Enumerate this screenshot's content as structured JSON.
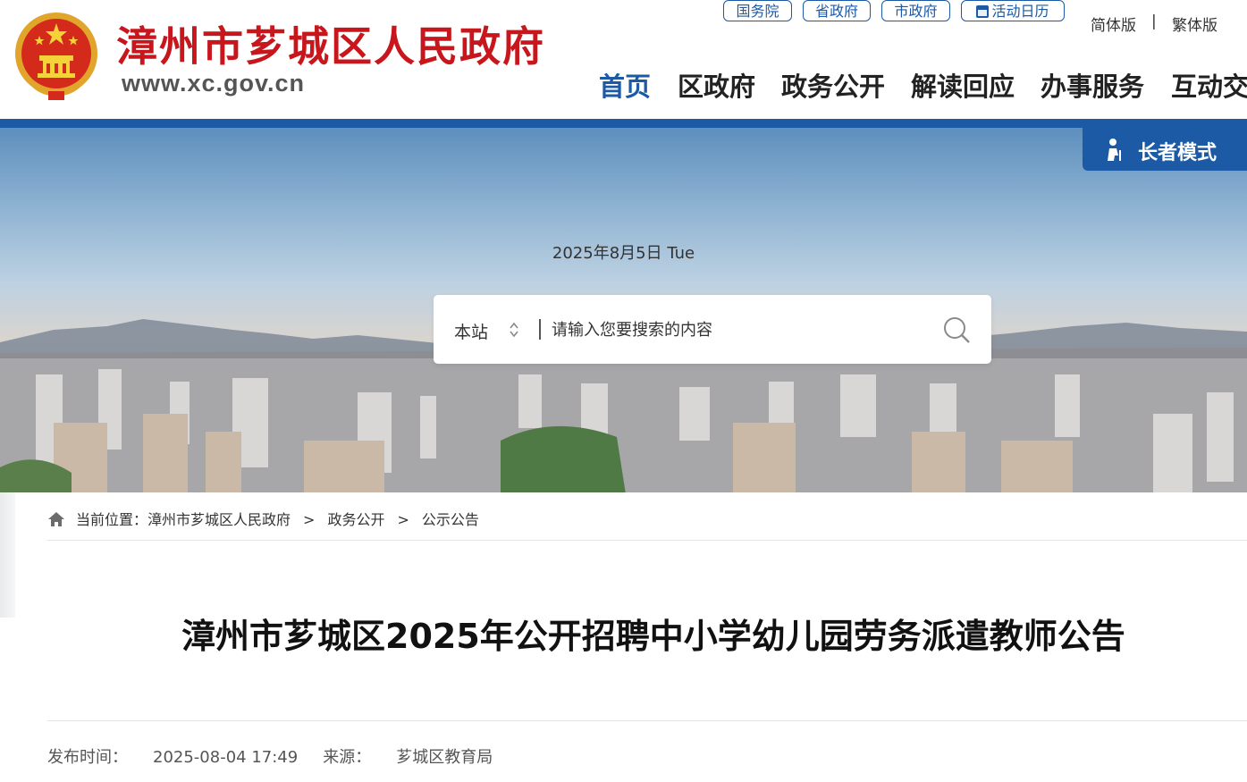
{
  "header": {
    "site_name": "漳州市芗城区人民政府",
    "site_url": "www.xc.gov.cn",
    "top_links": [
      "国务院",
      "省政府",
      "市政府",
      "活动日历"
    ],
    "lang": {
      "simplified": "简体版",
      "separator": "|",
      "traditional": "繁体版"
    },
    "nav": [
      "首页",
      "区政府",
      "政务公开",
      "解读回应",
      "办事服务",
      "互动交"
    ],
    "active_nav": "首页"
  },
  "banner": {
    "elder_mode_label": "长者模式",
    "date": "2025年8月5日 Tue",
    "search": {
      "scope": "本站",
      "placeholder": "请输入您要搜索的内容"
    }
  },
  "breadcrumb": {
    "prefix": "当前位置：",
    "items": [
      "漳州市芗城区人民政府",
      "政务公开",
      "公示公告"
    ],
    "separator": ">"
  },
  "article": {
    "title": "漳州市芗城区2025年公开招聘中小学幼儿园劳务派遣教师公告",
    "publish_label": "发布时间：",
    "publish_time": "2025-08-04 17:49",
    "source_label": "来源：",
    "source": "芗城区教育局"
  },
  "colors": {
    "brand_red": "#c8161d",
    "primary_blue": "#1c5aa6"
  }
}
